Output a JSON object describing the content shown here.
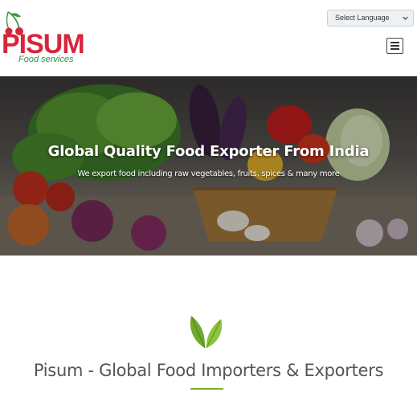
{
  "brand": {
    "name": "Pisum",
    "logo_text": "PISUM",
    "tagline": "Food services",
    "colors": {
      "red": "#d6263c",
      "green": "#2f8f3b",
      "accent_green": "#7fb02d"
    }
  },
  "header": {
    "language_select": {
      "selected": "Select Language",
      "icon": "chevron-down-icon"
    },
    "menu_icon": "hamburger-menu-icon"
  },
  "hero": {
    "title": "Global Quality Food Exporter From India",
    "subtitle": "We export food including raw vegetables, fruits, spices & many more"
  },
  "intro": {
    "icon": "leaf-icon",
    "title": "Pisum - Global Food Importers & Exporters"
  }
}
